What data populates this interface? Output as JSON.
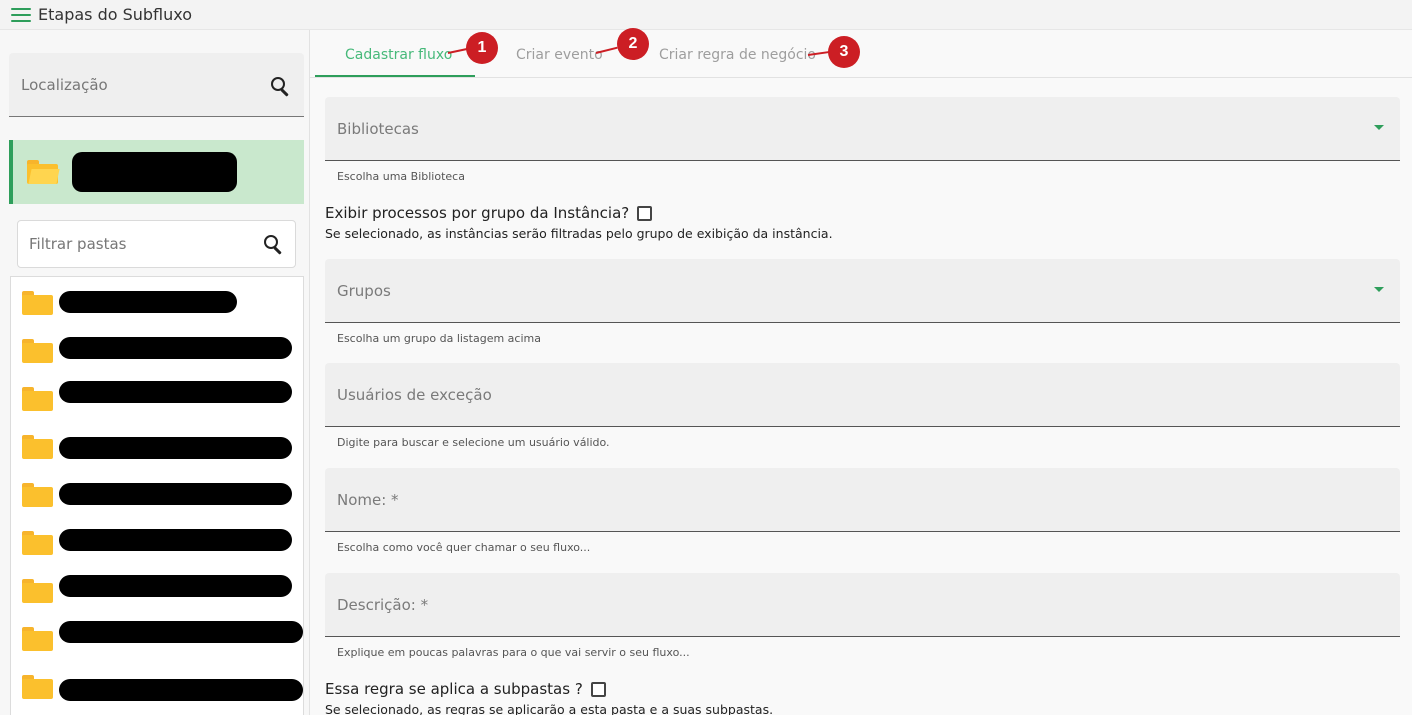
{
  "header": {
    "title": "Etapas do Subfluxo"
  },
  "sidebar": {
    "location_label": "Localização",
    "filter_placeholder": "Filtrar pastas",
    "folders": [
      {
        "name": "",
        "redacted": true
      },
      {
        "name": "",
        "redacted": true
      },
      {
        "name": "",
        "redacted": true
      },
      {
        "name": "",
        "redacted": true
      },
      {
        "name": "",
        "redacted": true
      },
      {
        "name": "",
        "redacted": true
      },
      {
        "name": "",
        "redacted": true
      },
      {
        "name": "",
        "redacted": true
      },
      {
        "name": "",
        "redacted": true
      }
    ]
  },
  "tabs": [
    {
      "label": "Cadastrar fluxo",
      "active": true,
      "marker": "1"
    },
    {
      "label": "Criar evento",
      "active": false,
      "marker": "2"
    },
    {
      "label": "Criar regra de negócio",
      "active": false,
      "marker": "3"
    }
  ],
  "form": {
    "bibliotecas": {
      "label": "Bibliotecas",
      "hint": "Escolha uma Biblioteca"
    },
    "exibir_processos": {
      "label": "Exibir processos por grupo da Instância?",
      "hint": "Se selecionado, as instâncias serão filtradas pelo grupo de exibição da instância.",
      "checked": false
    },
    "grupos": {
      "label": "Grupos",
      "hint": "Escolha um grupo da listagem acima"
    },
    "usuarios_excecao": {
      "label": "Usuários de exceção",
      "hint": "Digite para buscar e selecione um usuário válido."
    },
    "nome": {
      "label": "Nome: *",
      "hint": "Escolha como você quer chamar o seu fluxo..."
    },
    "descricao": {
      "label": "Descrição: *",
      "hint": "Explique em poucas palavras para o que vai servir o seu fluxo..."
    },
    "subpastas": {
      "label": "Essa regra se aplica a subpastas ?",
      "hint": "Se selecionado, as regras se aplicarão a esta pasta e a suas subpastas.",
      "checked": false
    }
  },
  "colors": {
    "accent": "#2e9e5b",
    "marker": "#cc1e24",
    "selected_bg": "#c9e8cd"
  }
}
